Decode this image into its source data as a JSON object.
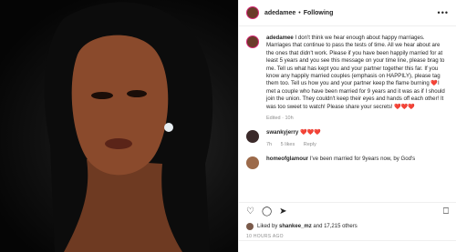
{
  "header": {
    "username": "adedamee",
    "follow_label": "Following"
  },
  "caption": {
    "username": "adedamee",
    "text": "I don't think we hear enough about happy marriages. Marriages that continue to pass the tests of time. All we hear about are the ones that didn't work. Please if you have been happily married for at least 5 years and you see this message on your time line, please brag to me. Tell us what has kept you and your partner together this far. If you know any happily married couples (emphasis on HAPPILY), please tag them too. Tell us how you and your partner keep the flame burning ❤️I met a couple who have been married for 9 years and it was as if I should join the union. They couldn't keep their eyes and hands off each other! It was too sweet to watch! Please share your secrets! ❤️❤️❤️",
    "meta": "Edited · 10h"
  },
  "comments": [
    {
      "username": "swankyjerry",
      "text": "❤️❤️❤️",
      "time": "7h",
      "likes": "5 likes",
      "reply": "Reply"
    },
    {
      "username": "homeofglamour",
      "text": "I've been married for 9years now, by God's"
    }
  ],
  "likes": {
    "text_prefix": "Liked by",
    "user": "shankee_mz",
    "text_suffix": "and 17,215 others"
  },
  "timestamp": "10 HOURS AGO"
}
